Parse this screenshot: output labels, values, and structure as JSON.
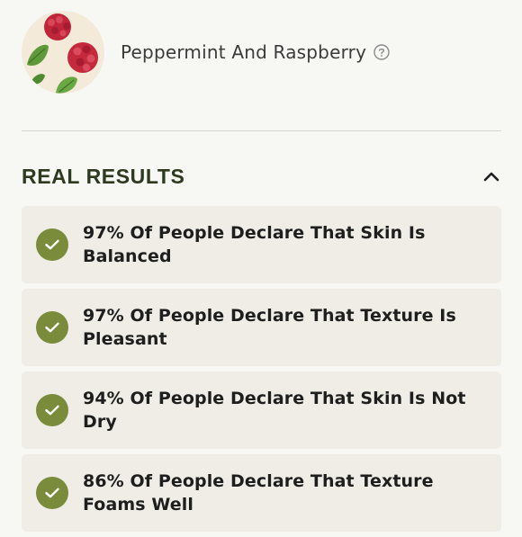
{
  "ingredient": {
    "name": "Peppermint And Raspberry",
    "help_icon": "question-circle-icon"
  },
  "section": {
    "title": "REAL RESULTS",
    "toggle_icon": "chevron-up-icon"
  },
  "results": [
    {
      "text": "97% Of People Declare That Skin Is Balanced"
    },
    {
      "text": "97% Of People Declare That Texture Is Pleasant"
    },
    {
      "text": "94% Of People Declare That Skin Is Not Dry"
    },
    {
      "text": "86% Of People Declare That Texture Foams Well"
    }
  ],
  "colors": {
    "accent_green": "#7a8c3c",
    "card_bg": "#efede6",
    "title_color": "#2d3a1f"
  }
}
